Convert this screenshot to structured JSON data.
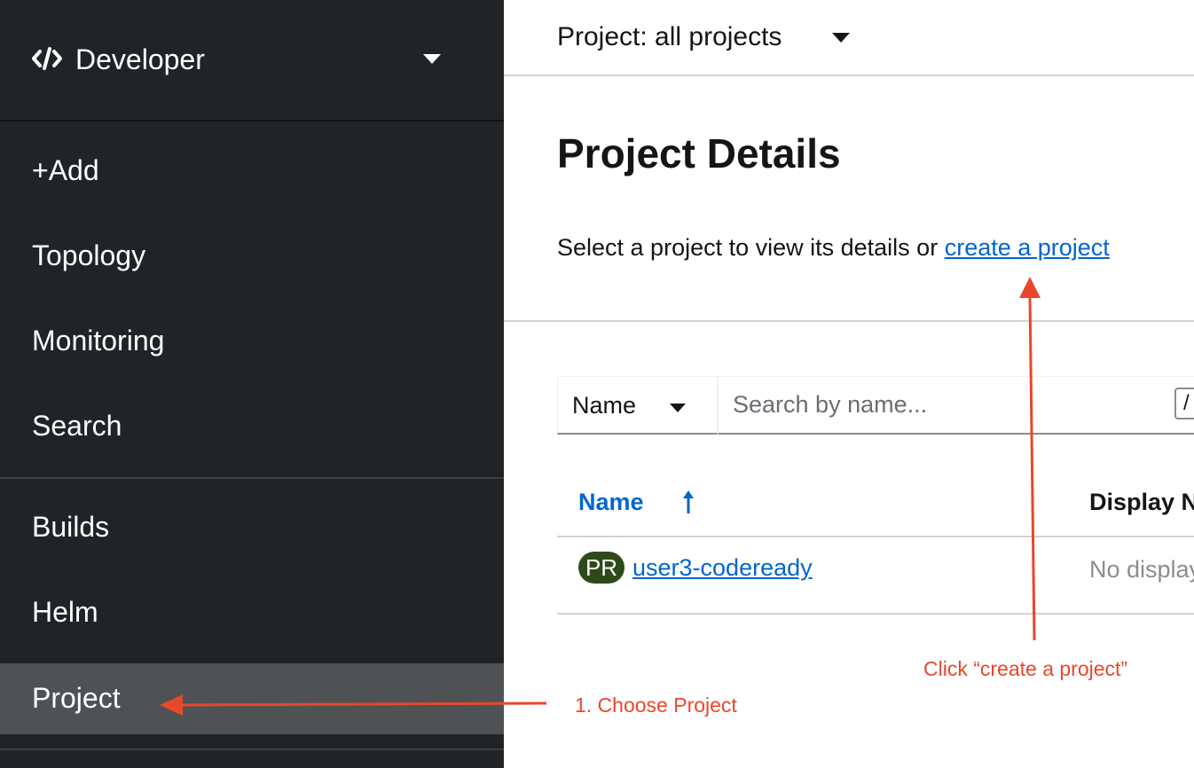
{
  "sidebar": {
    "perspective": {
      "label": "Developer",
      "icon": "code-icon"
    },
    "items": [
      {
        "label": "+Add"
      },
      {
        "label": "Topology"
      },
      {
        "label": "Monitoring"
      },
      {
        "label": "Search"
      },
      {
        "label": "Builds"
      },
      {
        "label": "Helm"
      },
      {
        "label": "Project",
        "active": true
      }
    ]
  },
  "topbar": {
    "project_selector": "Project: all projects"
  },
  "main": {
    "title": "Project Details",
    "description_prefix": "Select a project to view its details or ",
    "create_link": "create a project",
    "filter": {
      "selected": "Name",
      "placeholder": "Search by name...",
      "shortcut_hint": "/"
    },
    "table": {
      "columns": [
        {
          "label": "Name",
          "sorted": "asc"
        },
        {
          "label": "Display N"
        }
      ],
      "rows": [
        {
          "badge": "PR",
          "name": "user3-codeready",
          "display_name": "No display"
        }
      ]
    }
  },
  "annotations": {
    "create": "Click “create a project”",
    "choose": "1. Choose Project"
  },
  "colors": {
    "sidebar_bg": "#212427",
    "active_bg": "#4f5255",
    "link": "#0066cc",
    "annotation": "#e8472b",
    "badge": "#2e4a1a"
  }
}
